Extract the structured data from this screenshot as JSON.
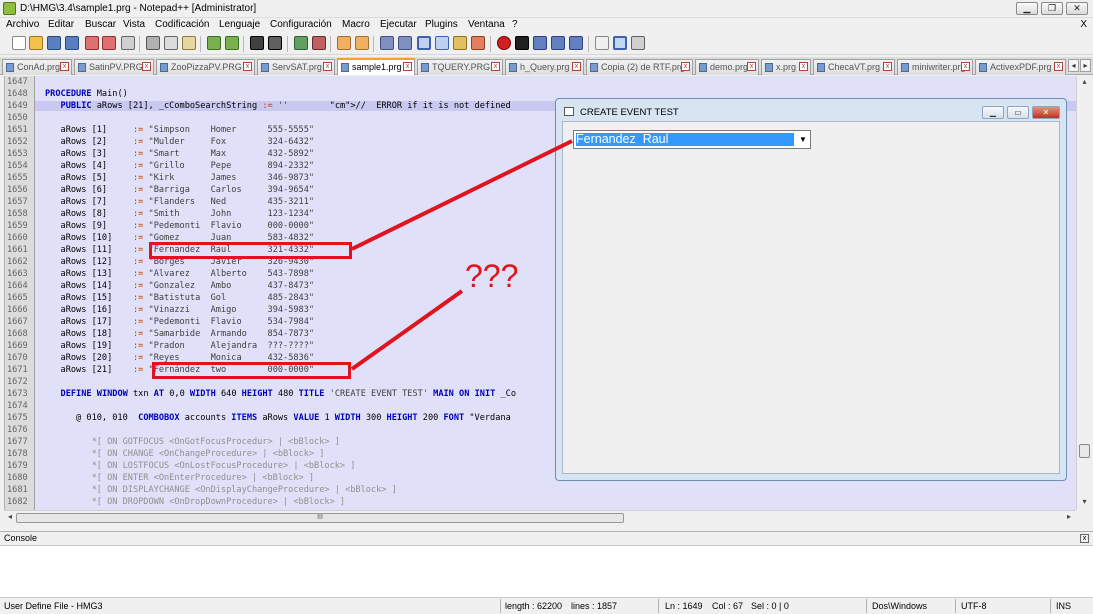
{
  "window": {
    "title": "D:\\HMG\\3.4\\sample1.prg - Notepad++ [Administrator]",
    "buttons": [
      "▁",
      "❐",
      "✕"
    ]
  },
  "menu": [
    "Archivo",
    "Editar",
    "Buscar",
    "Vista",
    "Codificación",
    "Lenguaje",
    "Configuración",
    "Macro",
    "Ejecutar",
    "Plugins",
    "Ventana",
    "?"
  ],
  "menu_close": "X",
  "tabs": [
    "ConAd.prg",
    "SatinPV.PRG",
    "ZooPizzaPV.PRG",
    "ServSAT.prg",
    "sample1.prg",
    "TQUERY.PRG",
    "h_Query.prg",
    "Copia (2) de RTF.prg",
    "demo.prg",
    "x.prg",
    "ChecaVT.prg",
    "miniwriter.prg",
    "ActivexPDF.prg"
  ],
  "active_tab": "sample1.prg",
  "editor": {
    "lines": [
      {
        "n": "1647",
        "t": ""
      },
      {
        "n": "1648",
        "t": "PROCEDURE Main()"
      },
      {
        "n": "1649",
        "t": "   PUBLIC aRows [21], _cComboSearchString := ''        //  ERROR if it is not defined"
      },
      {
        "n": "1650",
        "t": ""
      },
      {
        "n": "1651",
        "t": "   aRows [1]     := \"Simpson    Homer      555-5555\""
      },
      {
        "n": "1652",
        "t": "   aRows [2]     := \"Mulder     Fox        324-6432\""
      },
      {
        "n": "1653",
        "t": "   aRows [3]     := \"Smart      Max        432-5892\""
      },
      {
        "n": "1654",
        "t": "   aRows [4]     := \"Grillo     Pepe       894-2332\""
      },
      {
        "n": "1655",
        "t": "   aRows [5]     := \"Kirk       James      346-9873\""
      },
      {
        "n": "1656",
        "t": "   aRows [6]     := \"Barriga    Carlos     394-9654\""
      },
      {
        "n": "1657",
        "t": "   aRows [7]     := \"Flanders   Ned        435-3211\""
      },
      {
        "n": "1658",
        "t": "   aRows [8]     := \"Smith      John       123-1234\""
      },
      {
        "n": "1659",
        "t": "   aRows [9]     := \"Pedemonti  Flavio     000-0000\""
      },
      {
        "n": "1660",
        "t": "   aRows [10]    := \"Gomez      Juan       583-4832\""
      },
      {
        "n": "1661",
        "t": "   aRows [11]    := \"Fernandez  Raul       321-4332\""
      },
      {
        "n": "1662",
        "t": "   aRows [12]    := \"Borges     Javier     326-9430\""
      },
      {
        "n": "1663",
        "t": "   aRows [13]    := \"Alvarez    Alberto    543-7898\""
      },
      {
        "n": "1664",
        "t": "   aRows [14]    := \"Gonzalez   Ambo       437-8473\""
      },
      {
        "n": "1665",
        "t": "   aRows [15]    := \"Batistuta  Gol        485-2843\""
      },
      {
        "n": "1666",
        "t": "   aRows [16]    := \"Vinazzi    Amigo      394-5983\""
      },
      {
        "n": "1667",
        "t": "   aRows [17]    := \"Pedemonti  Flavio     534-7984\""
      },
      {
        "n": "1668",
        "t": "   aRows [18]    := \"Samarbide  Armando    854-7873\""
      },
      {
        "n": "1669",
        "t": "   aRows [19]    := \"Pradon     Alejandra  ???-????\""
      },
      {
        "n": "1670",
        "t": "   aRows [20]    := \"Reyes      Monica     432-5836\""
      },
      {
        "n": "1671",
        "t": "   aRows [21]    := \"Fernández  two        000-0000\""
      },
      {
        "n": "1672",
        "t": ""
      },
      {
        "n": "1673",
        "t": "   DEFINE WINDOW txn AT 0,0 WIDTH 640 HEIGHT 480 TITLE 'CREATE EVENT TEST' MAIN ON INIT _Co"
      },
      {
        "n": "1674",
        "t": ""
      },
      {
        "n": "1675",
        "t": "      @ 010, 010  COMBOBOX accounts ITEMS aRows VALUE 1 WIDTH 300 HEIGHT 200 FONT \"Verdana"
      },
      {
        "n": "1676",
        "t": ""
      },
      {
        "n": "1677",
        "t": "         *[ ON GOTFOCUS <OnGotFocusProcedur> | <bBlock> ]"
      },
      {
        "n": "1678",
        "t": "         *[ ON CHANGE <OnChangeProcedure> | <bBlock> ]"
      },
      {
        "n": "1679",
        "t": "         *[ ON LOSTFOCUS <OnLostFocusProcedure> | <bBlock> ]"
      },
      {
        "n": "1680",
        "t": "         *[ ON ENTER <OnEnterProcedure> | <bBlock> ]"
      },
      {
        "n": "1681",
        "t": "         *[ ON DISPLAYCHANGE <OnDisplayChangeProcedure> | <bBlock> ]"
      },
      {
        "n": "1682",
        "t": "         *[ ON DROPDOWN <OnDropDownProcedure> | <bBlock> ]"
      }
    ],
    "highlighted_line": "1649",
    "hscroll_grip": "III"
  },
  "dialog": {
    "title": "CREATE EVENT TEST",
    "combo_value": "Fernandez  Raul",
    "buttons": [
      "▁",
      "▭",
      "✕"
    ]
  },
  "annotation": {
    "text": "???",
    "color": "#e0141e"
  },
  "console": {
    "title": "Console",
    "close": "x"
  },
  "status": {
    "file_type": "User Define File - HMG3",
    "length": "length : 62200",
    "lines": "lines : 1857",
    "ln": "Ln : 1649",
    "col": "Col : 67",
    "sel": "Sel : 0 | 0",
    "eol": "Dos\\Windows",
    "encoding": "UTF-8",
    "mode": "INS"
  },
  "colors": {
    "editor_bg": "#e0e0f8",
    "accent_red": "#e0141e",
    "selection": "#3399ff"
  }
}
